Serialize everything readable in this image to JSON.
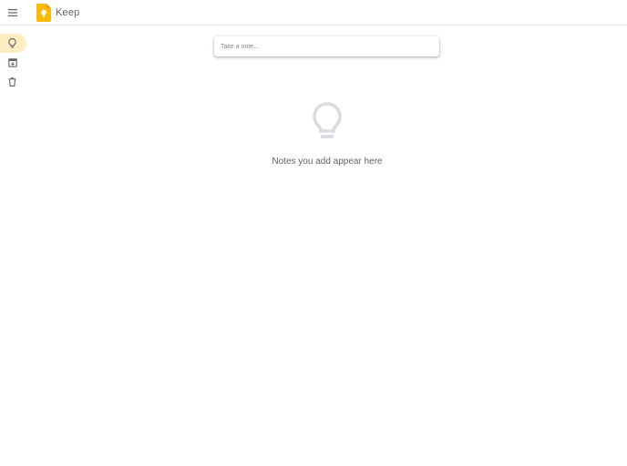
{
  "header": {
    "menu_icon": "hamburger-menu-icon",
    "logo_icon": "keep-logo-icon",
    "app_title": "Keep"
  },
  "sidebar": {
    "items": [
      {
        "icon": "lightbulb-icon",
        "id": "notes",
        "active": true
      },
      {
        "icon": "archive-icon",
        "id": "archive",
        "active": false
      },
      {
        "icon": "trash-icon",
        "id": "trash",
        "active": false
      }
    ]
  },
  "note_input": {
    "placeholder": "Take a note...",
    "value": ""
  },
  "empty_state": {
    "icon": "lightbulb-outline-icon",
    "message": "Notes you add appear here"
  },
  "colors": {
    "accent": "#f9bb08",
    "active_bg": "#feefc3",
    "icon": "#5f6368",
    "empty_icon": "#dadce0"
  }
}
